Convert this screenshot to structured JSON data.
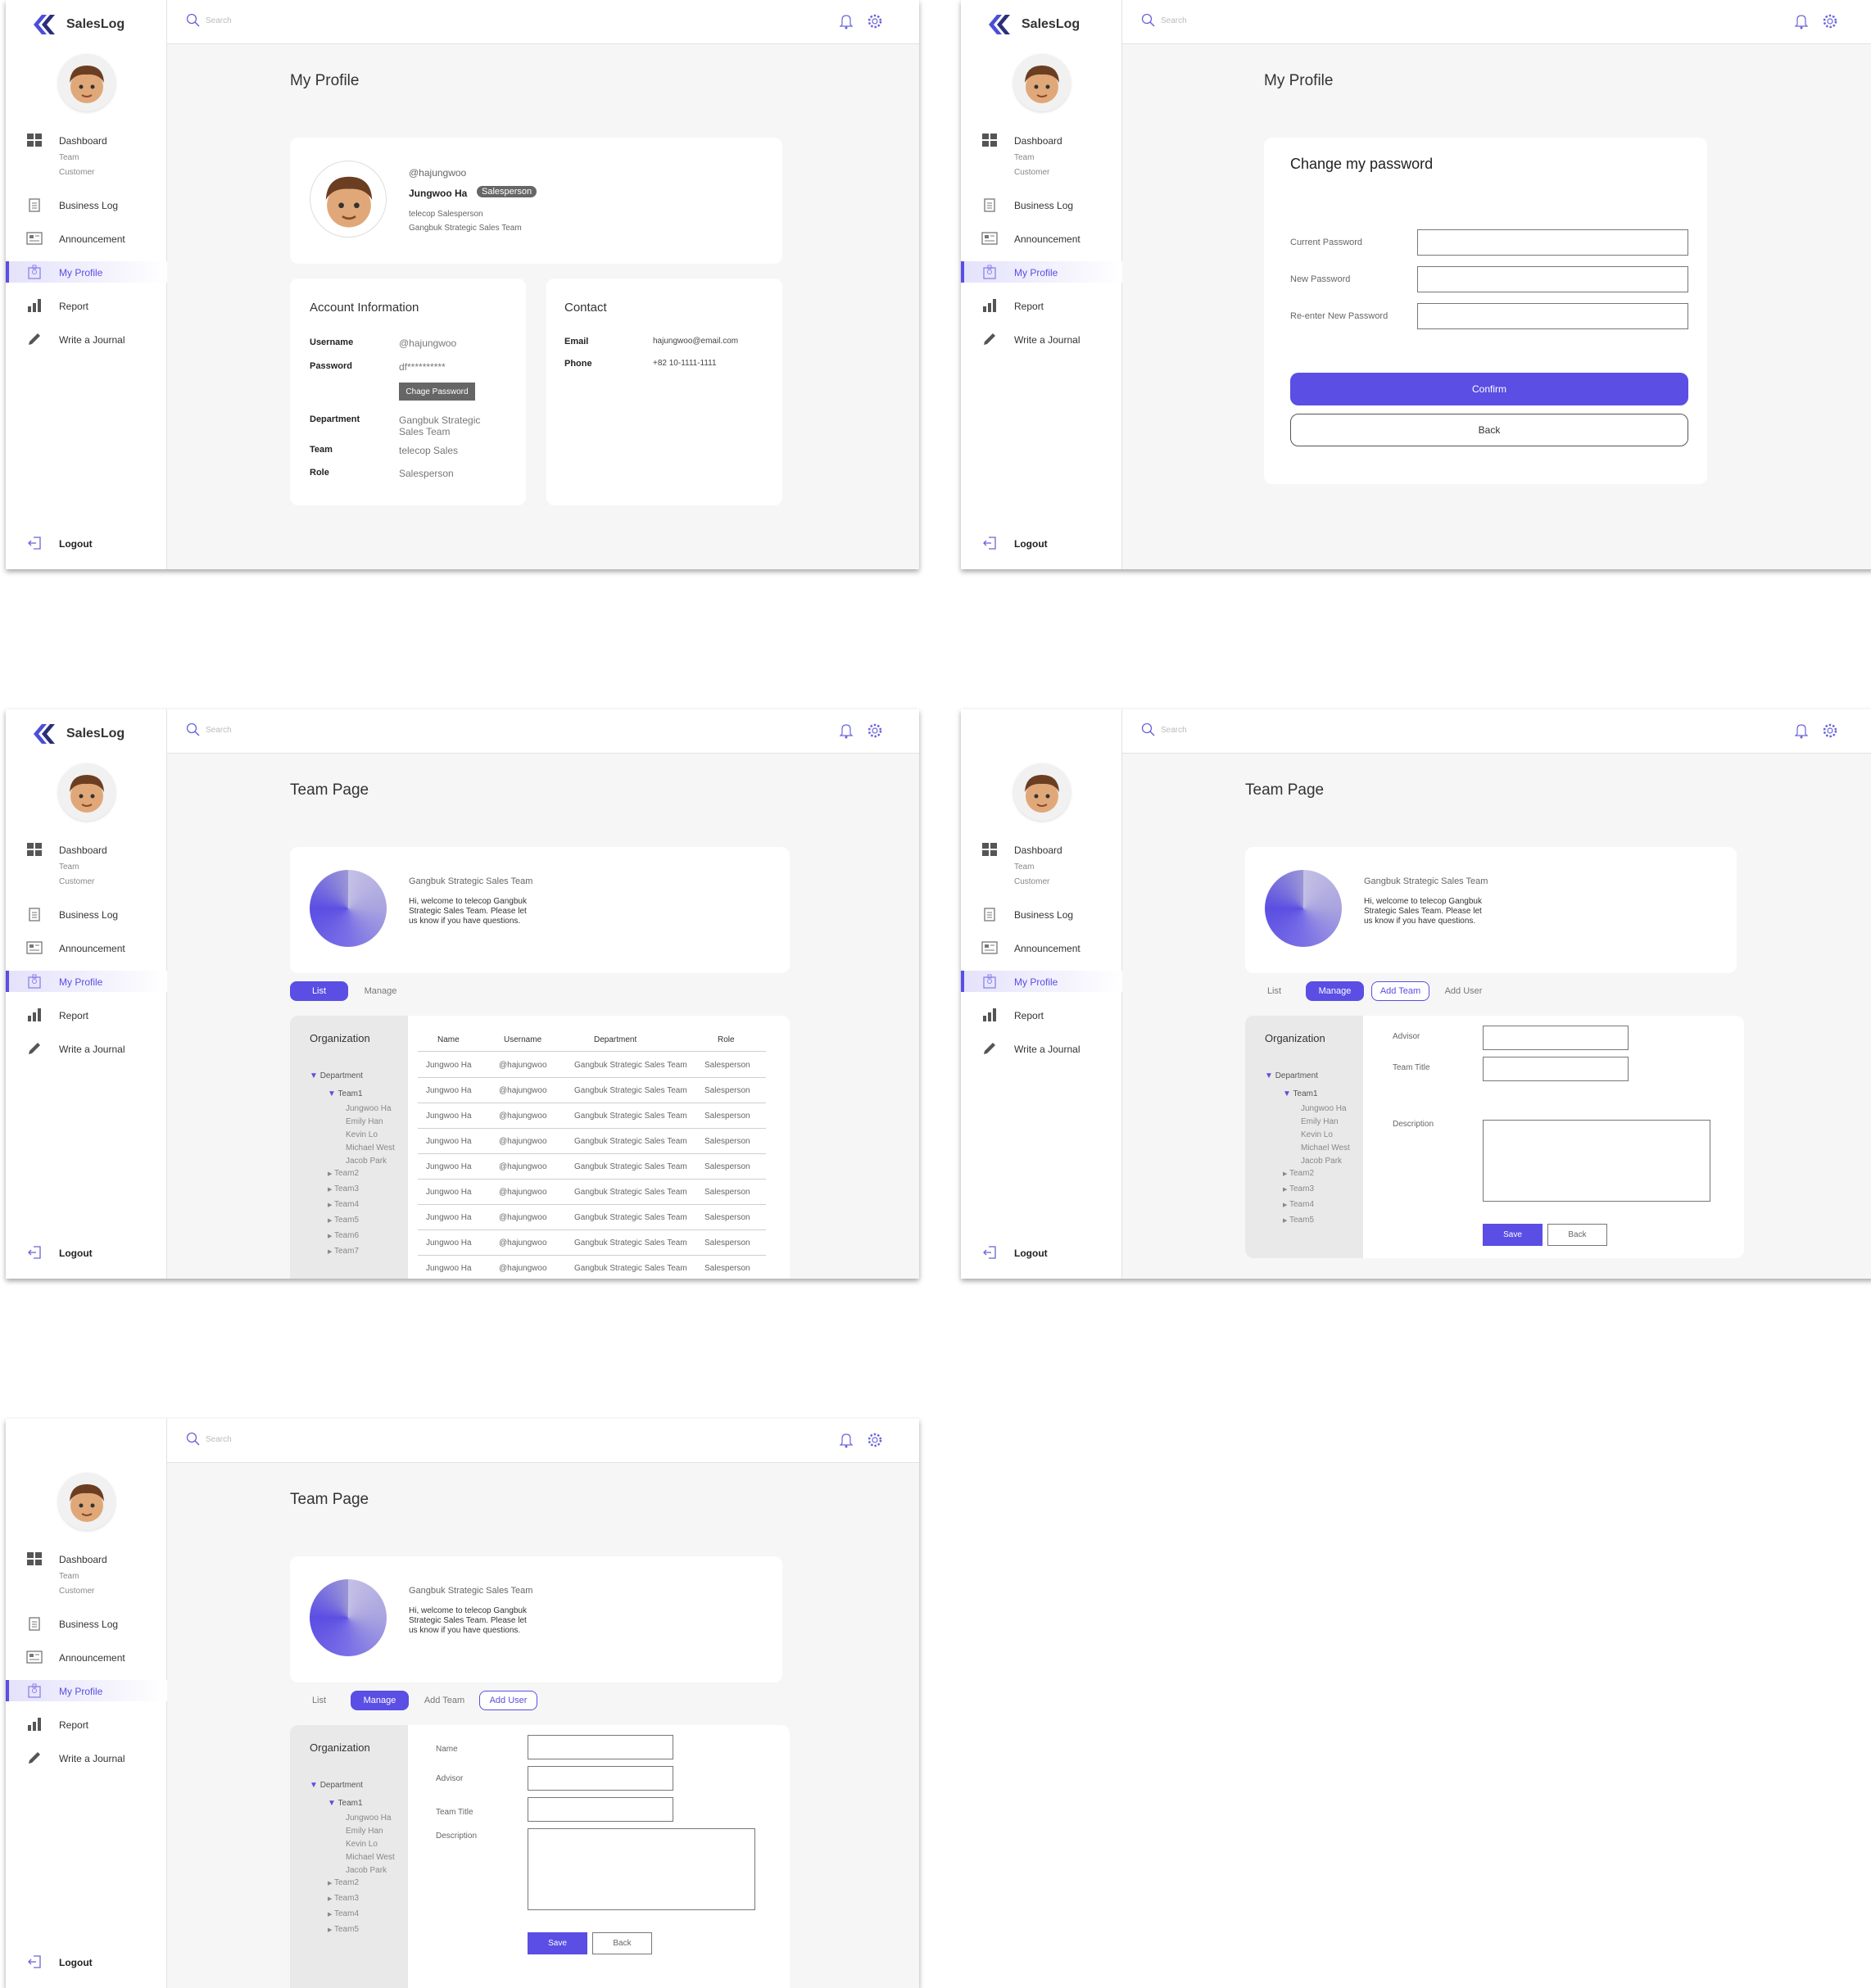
{
  "app": {
    "logo": "SalesLog",
    "search_placeholder": "Search",
    "accent": "#5a4ee4"
  },
  "nav": {
    "dashboard": "Dashboard",
    "team": "Team",
    "customer": "Customer",
    "business_log": "Business Log",
    "announcement": "Announcement",
    "my_profile": "My Profile",
    "report": "Report",
    "journal": "Write a Journal",
    "logout": "Logout"
  },
  "profile": {
    "title": "My Profile",
    "handle": "@hajungwoo",
    "name": "Jungwoo Ha",
    "badge": "Salesperson",
    "line1": "telecop Salesperson",
    "line2": "Gangbuk Strategic Sales Team",
    "account": {
      "title": "Account Information",
      "username_label": "Username",
      "username": "@hajungwoo",
      "password_label": "Password",
      "password": "df**********",
      "change_btn": "Chage Password",
      "dept_label": "Department",
      "dept1": "Gangbuk Strategic",
      "dept2": "Sales Team",
      "team_label": "Team",
      "team": "telecop Sales",
      "role_label": "Role",
      "role": "Salesperson"
    },
    "contact": {
      "title": "Contact",
      "email_label": "Email",
      "email": "hajungwoo@email.com",
      "phone_label": "Phone",
      "phone": "+82 10-1111-1111"
    }
  },
  "password": {
    "title": "My Profile",
    "card_title": "Change my password",
    "current": "Current Password",
    "new": "New Password",
    "reenter": "Re-enter New Password",
    "confirm": "Confirm",
    "back": "Back"
  },
  "team": {
    "title": "Team Page",
    "name": "Gangbuk Strategic Sales Team",
    "welcome1": "Hi, welcome to telecop Gangbuk",
    "welcome2": "Strategic Sales Team. Please let",
    "welcome3": "us know if you have questions.",
    "tabs": {
      "list": "List",
      "manage": "Manage",
      "add_team": "Add Team",
      "add_user": "Add User"
    },
    "org_title": "Organization",
    "dept": "Department",
    "team1": "Team1",
    "members": [
      "Jungwoo Ha",
      "Emily Han",
      "Kevin Lo",
      "Michael West",
      "Jacob Park"
    ],
    "teams": [
      "Team2",
      "Team3",
      "Team4",
      "Team5",
      "Team6",
      "Team7"
    ],
    "columns": [
      "Name",
      "Username",
      "Department",
      "Role"
    ],
    "rows": [
      [
        "Jungwoo Ha",
        "@hajungwoo",
        "Gangbuk Strategic Sales Team",
        "Salesperson"
      ],
      [
        "Jungwoo Ha",
        "@hajungwoo",
        "Gangbuk Strategic Sales Team",
        "Salesperson"
      ],
      [
        "Jungwoo Ha",
        "@hajungwoo",
        "Gangbuk Strategic Sales Team",
        "Salesperson"
      ],
      [
        "Jungwoo Ha",
        "@hajungwoo",
        "Gangbuk Strategic Sales Team",
        "Salesperson"
      ],
      [
        "Jungwoo Ha",
        "@hajungwoo",
        "Gangbuk Strategic Sales Team",
        "Salesperson"
      ],
      [
        "Jungwoo Ha",
        "@hajungwoo",
        "Gangbuk Strategic Sales Team",
        "Salesperson"
      ],
      [
        "Jungwoo Ha",
        "@hajungwoo",
        "Gangbuk Strategic Sales Team",
        "Salesperson"
      ],
      [
        "Jungwoo Ha",
        "@hajungwoo",
        "Gangbuk Strategic Sales Team",
        "Salesperson"
      ],
      [
        "Jungwoo Ha",
        "@hajungwoo",
        "Gangbuk Strategic Sales Team",
        "Salesperson"
      ]
    ],
    "form": {
      "name": "Name",
      "advisor": "Advisor",
      "team_title": "Team Title",
      "description": "Description",
      "save": "Save",
      "back": "Back"
    }
  }
}
